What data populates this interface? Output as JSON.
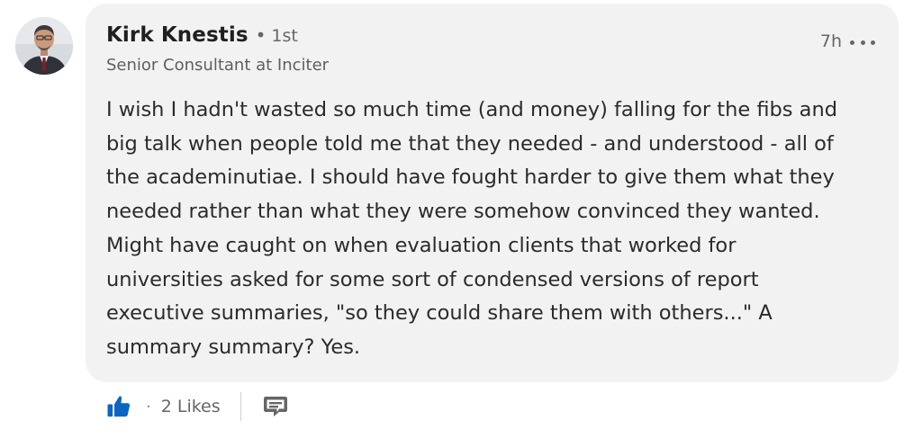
{
  "comment": {
    "author": {
      "name": "Kirk Knestis",
      "degree": "1st",
      "headline": "Senior Consultant at Inciter",
      "avatar_icon": "profile-photo"
    },
    "timestamp": "7h",
    "more_icon": "more-options-icon",
    "body_lines": [
      "I wish I hadn't wasted so much time (and money) falling for the fibs and",
      "big talk when people told me that they needed - and understood - all of",
      "the academinutiae. I should have fought harder to give them what they",
      "needed rather than what they were somehow convinced they wanted.",
      "Might have caught on when evaluation clients that worked for",
      "universities asked for some sort of condensed versions of report",
      "executive summaries, \"so they could share them with others...\" A",
      "summary summary? Yes."
    ]
  },
  "actions": {
    "like_icon": "thumbs-up-icon",
    "likes": "2 Likes",
    "reply_icon": "comment-icon",
    "colors": {
      "like": "#0a66c2",
      "icon_gray": "#666666"
    }
  },
  "colors": {
    "bubble": "#f2f2f2",
    "text": "#2b2b2b",
    "muted": "#666666"
  }
}
